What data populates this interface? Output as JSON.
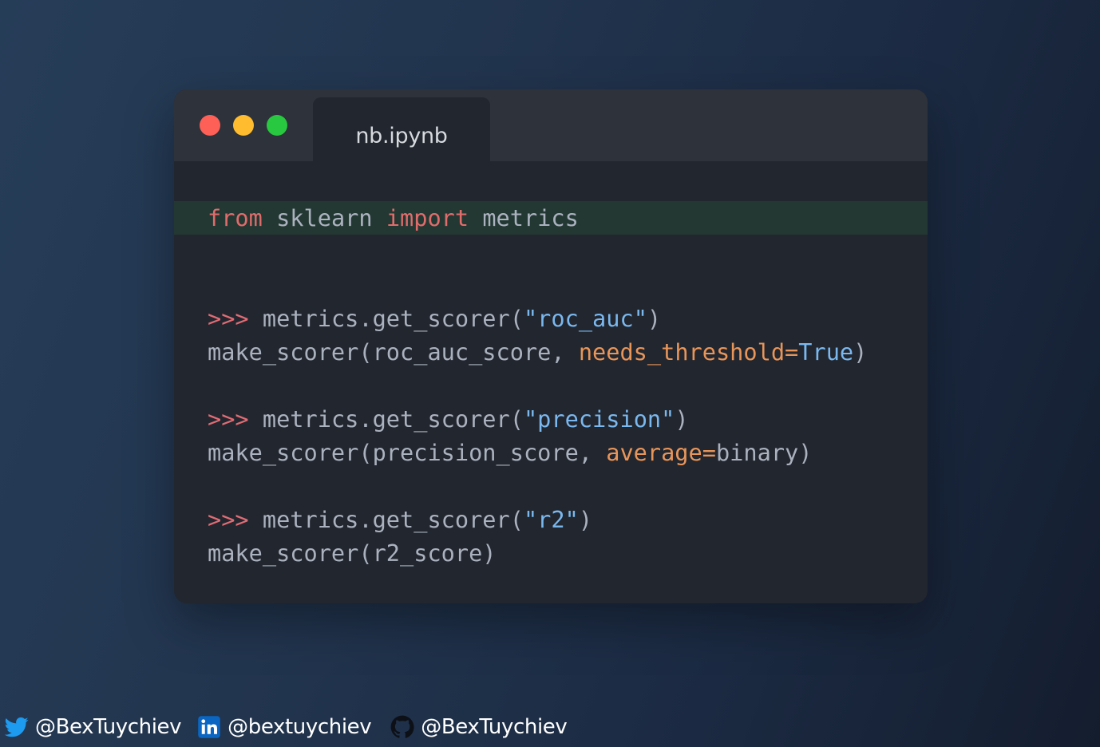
{
  "tab": {
    "filename": "nb.ipynb"
  },
  "code": {
    "import_line": {
      "kw_from": "from",
      "module": " sklearn ",
      "kw_import": "import",
      "name": " metrics"
    },
    "blocks": [
      {
        "prompt": ">>>",
        "call": " metrics.get_scorer(",
        "arg": "\"roc_auc\"",
        "call_end": ")",
        "out_start": "make_scorer(roc_auc_score, ",
        "param": "needs_threshold",
        "eq": "=",
        "value": "True",
        "out_end": ")"
      },
      {
        "prompt": ">>>",
        "call": " metrics.get_scorer(",
        "arg": "\"precision\"",
        "call_end": ")",
        "out_start": "make_scorer(precision_score, ",
        "param": "average",
        "eq": "=",
        "value": "binary",
        "out_end": ")"
      },
      {
        "prompt": ">>>",
        "call": " metrics.get_scorer(",
        "arg": "\"r2\"",
        "call_end": ")",
        "out": "make_scorer(r2_score)"
      }
    ]
  },
  "footer": {
    "twitter": "@BexTuychiev",
    "linkedin": "@bextuychiev",
    "github": "@BexTuychiev"
  },
  "icons": {
    "twitter": "twitter-bird-icon",
    "linkedin": "linkedin-icon",
    "github": "github-icon"
  },
  "colors": {
    "keyword": "#e06c6c",
    "string": "#7ab8ef",
    "param": "#e8955a",
    "text": "#abb2bf",
    "highlight": "#233832",
    "window": "#22262e",
    "titlebar": "#2e323a"
  }
}
